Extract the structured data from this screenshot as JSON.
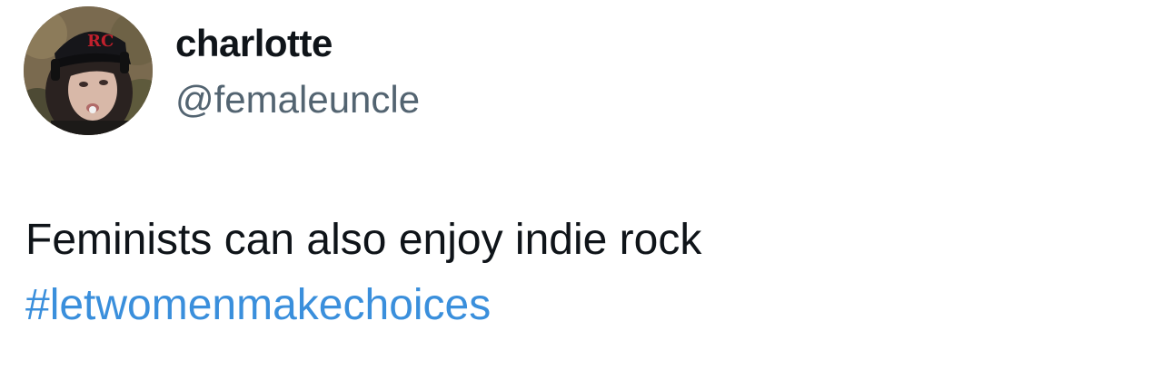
{
  "tweet": {
    "author": {
      "display_name": "charlotte",
      "handle": "@femaleuncle",
      "avatar_icon": "profile-photo"
    },
    "text": "Feminists can also enjoy indie rock",
    "hashtag": "#letwomenmakechoices"
  },
  "colors": {
    "name": "#0f1419",
    "handle": "#536471",
    "hashtag": "#3a8fdc",
    "background": "#ffffff"
  }
}
